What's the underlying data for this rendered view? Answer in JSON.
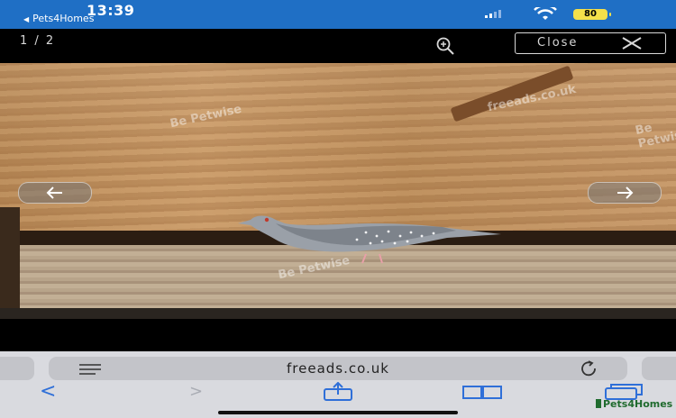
{
  "status_bar": {
    "time": "13:39",
    "back_app": "Pets4Homes",
    "battery": "80"
  },
  "viewer": {
    "counter": "1 / 2",
    "close_label": "Close",
    "watermark": "Be Petwise",
    "watermark_site": "freeads.co.uk"
  },
  "browser": {
    "url": "freeads.co.uk",
    "brand": "Pets4Homes"
  },
  "colors": {
    "status_bar": "#1f6fc5",
    "toolbar_accent": "#2f6fd8",
    "battery": "#f5e04a",
    "brand_green": "#1f6b2e"
  }
}
